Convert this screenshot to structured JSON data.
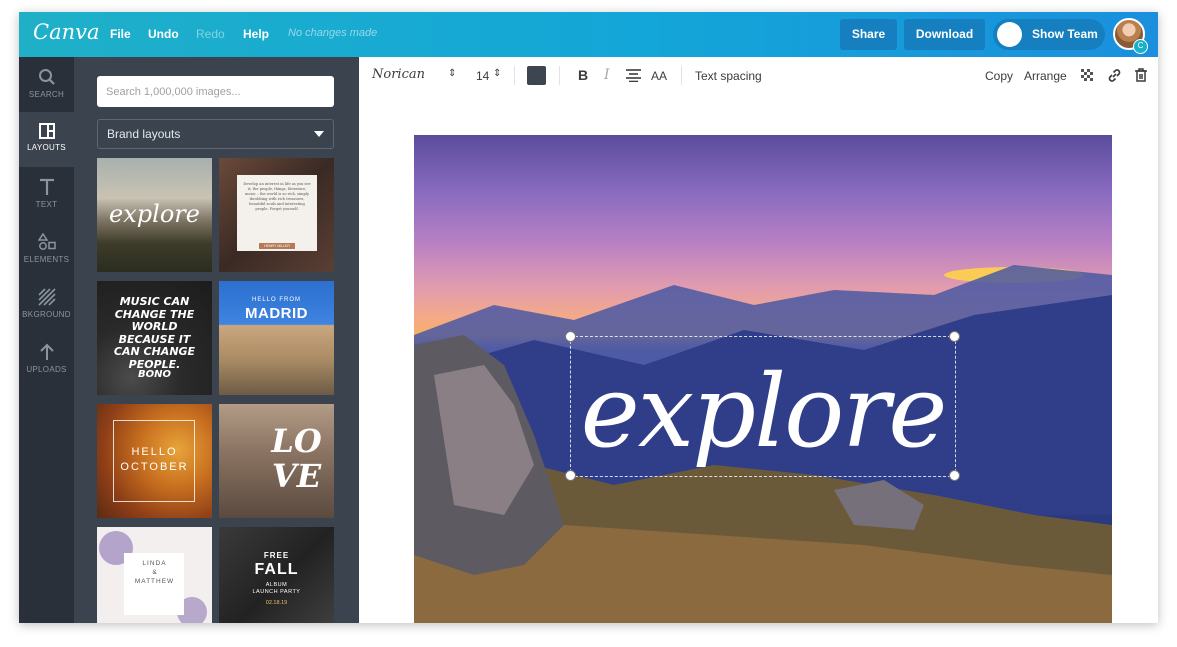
{
  "app": {
    "logo": "Canva",
    "status": "No changes made"
  },
  "menu": {
    "file": "File",
    "undo": "Undo",
    "redo": "Redo",
    "help": "Help"
  },
  "actions": {
    "share": "Share",
    "download": "Download",
    "show_team": "Show Team",
    "avatar_badge": "C"
  },
  "nav": {
    "search": "SEARCH",
    "layouts": "LAYOUTS",
    "text": "TEXT",
    "elements": "ELEMENTS",
    "background": "BKGROUND",
    "uploads": "UPLOADS"
  },
  "panel": {
    "search_placeholder": "Search 1,000,000 images...",
    "dropdown_value": "Brand layouts",
    "thumbs": {
      "explore": "explore",
      "quote_text": "Develop an interest in life as you see it; the people, things, literature, music – the world is so rich, simply throbbing with rich treasures, beautiful souls and interesting people. Forget yourself.",
      "quote_footer": "HENRY MILLER",
      "music": "MUSIC CAN CHANGE THE WORLD BECAUSE IT CAN CHANGE PEOPLE.",
      "bono": "BONO",
      "madrid_small": "HELLO FROM",
      "madrid": "MADRID",
      "october_1": "HELLO",
      "october_2": "OCTOBER",
      "love_1": "LO",
      "love_2": "VE",
      "linda_1": "LINDA",
      "linda_2": "&",
      "linda_3": "MATTHEW",
      "fall_1": "FREE",
      "fall_2": "FALL",
      "fall_3": "ALBUM",
      "fall_4": "LAUNCH PARTY",
      "fall_5": "02.18.19"
    }
  },
  "toolbar": {
    "font": "Norican",
    "font_size": "14",
    "text_color": "#3d4650",
    "bold": "B",
    "italic": "I",
    "case": "AA",
    "text_spacing": "Text spacing",
    "copy": "Copy",
    "arrange": "Arrange"
  },
  "canvas": {
    "text": "explore"
  },
  "colors": {
    "topbar": "#13a6d8",
    "nav": "#293039",
    "panel": "#3a434e"
  }
}
